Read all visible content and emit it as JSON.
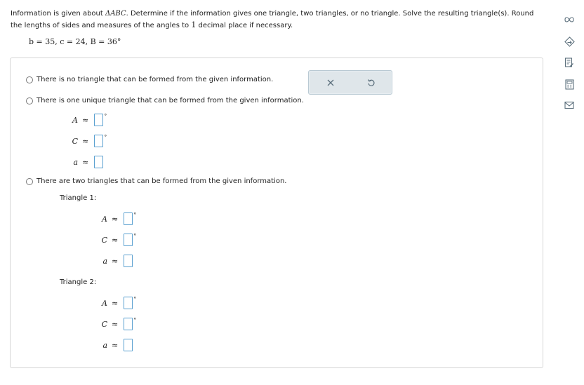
{
  "prompt": {
    "part1": "Information is given about ",
    "triangle_symbol": "ΔABC",
    "part2": ". Determine if the information gives one triangle, two triangles, or no triangle. Solve the resulting triangle(s). Round the lengths of sides and measures of the angles to ",
    "decimal_count": "1",
    "part3": " decimal place if necessary."
  },
  "given": "b = 35, c = 24, B = 36°",
  "options": {
    "none": "There is no triangle that can be formed from the given information.",
    "one": "There is one unique triangle that can be formed from the given information.",
    "two": "There are two triangles that can be formed from the given information."
  },
  "labels": {
    "A": "A",
    "C": "C",
    "a": "a",
    "approx": "≈",
    "degree": "°",
    "triangle1": "Triangle 1:",
    "triangle2": "Triangle 2:"
  },
  "icons": {
    "clear": "close-icon",
    "undo": "undo-icon",
    "sidebar": [
      "infinity-icon",
      "diamond-arrow-icon",
      "document-edit-icon",
      "calculator-icon",
      "mail-icon"
    ]
  },
  "colors": {
    "input_border": "#5aa0d0",
    "toolbar_bg": "#dfe6ea",
    "icon": "#5b6f7c"
  }
}
